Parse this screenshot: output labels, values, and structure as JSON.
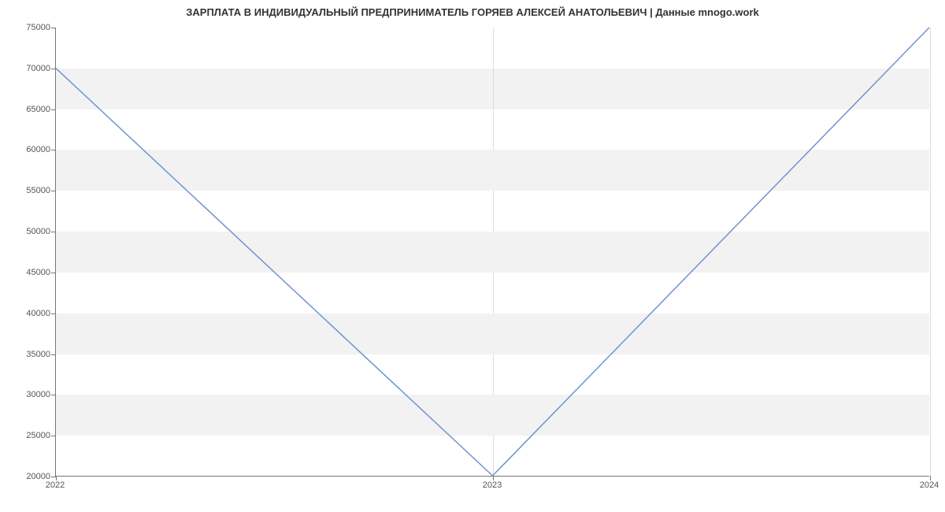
{
  "chart_data": {
    "type": "line",
    "title": "ЗАРПЛАТА В ИНДИВИДУАЛЬНЫЙ ПРЕДПРИНИМАТЕЛЬ ГОРЯЕВ АЛЕКСЕЙ АНАТОЛЬЕВИЧ | Данные mnogo.work",
    "x": [
      2022,
      2023,
      2024
    ],
    "values": [
      70000,
      20000,
      75000
    ],
    "xlabel": "",
    "ylabel": "",
    "xlim": [
      2022,
      2024
    ],
    "ylim": [
      20000,
      75000
    ],
    "x_ticks": [
      2022,
      2023,
      2024
    ],
    "y_ticks": [
      20000,
      25000,
      30000,
      35000,
      40000,
      45000,
      50000,
      55000,
      60000,
      65000,
      70000,
      75000
    ],
    "line_color": "#6f93d2",
    "band_color": "#f2f2f2"
  }
}
